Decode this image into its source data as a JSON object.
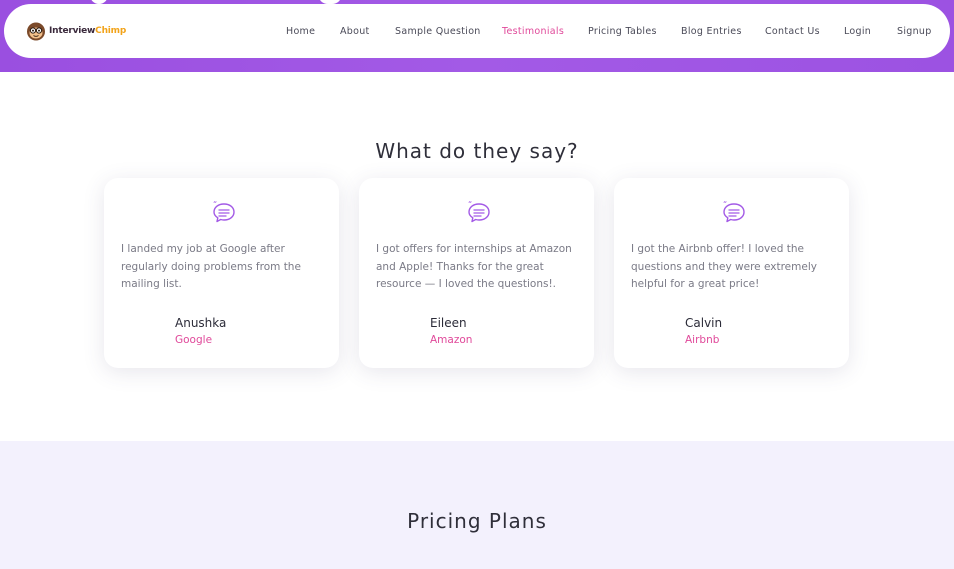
{
  "brand": {
    "name_part1": "Interview",
    "name_part2": "Chimp",
    "accent": "#e0499a",
    "nav_gradient": "#9a4fe0"
  },
  "nav": {
    "items": [
      {
        "label": "Home",
        "active": false
      },
      {
        "label": "About",
        "active": false
      },
      {
        "label": "Sample Question",
        "active": false
      },
      {
        "label": "Testimonials",
        "active": true
      },
      {
        "label": "Pricing Tables",
        "active": false
      },
      {
        "label": "Blog Entries",
        "active": false
      },
      {
        "label": "Contact Us",
        "active": false
      },
      {
        "label": "Login",
        "active": false
      },
      {
        "label": "Signup",
        "active": false
      }
    ]
  },
  "testimonials": {
    "title": "What do they say?",
    "icon": "quote-bubble-icon",
    "cards": [
      {
        "quote": "I landed my job at Google after regularly doing problems from the mailing list.",
        "name": "Anushka",
        "company": "Google"
      },
      {
        "quote": "I got offers for internships at Amazon and Apple! Thanks for the great resource — I loved the questions!.",
        "name": "Eileen",
        "company": "Amazon"
      },
      {
        "quote": "I got the Airbnb offer! I loved the questions and they were extremely helpful for a great price!",
        "name": "Calvin",
        "company": "Airbnb"
      }
    ]
  },
  "pricing": {
    "title": "Pricing Plans"
  }
}
